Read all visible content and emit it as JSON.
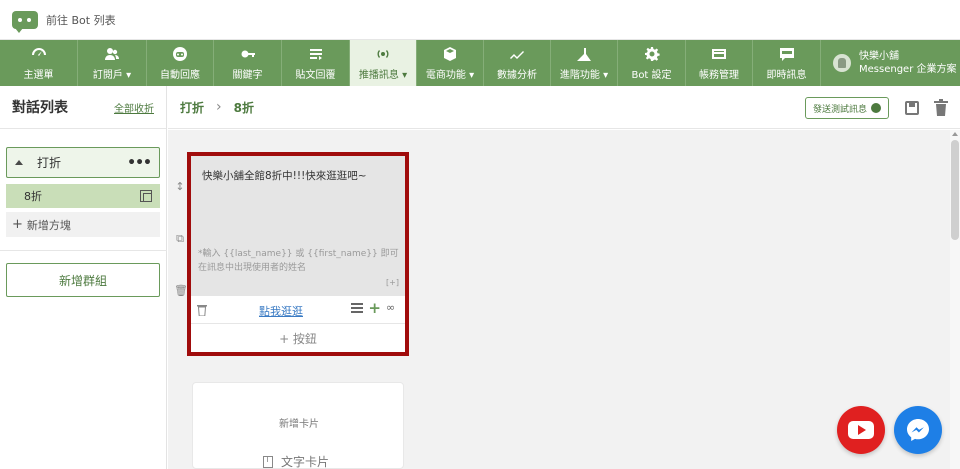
{
  "topbar": {
    "back_label": "前往 Bot 列表"
  },
  "nav": {
    "items": [
      {
        "label": "主選單",
        "icon": "dashboard-icon"
      },
      {
        "label": "訂閱戶 ▾",
        "icon": "users-icon"
      },
      {
        "label": "自動回應",
        "icon": "bot-face-icon"
      },
      {
        "label": "關鍵字",
        "icon": "key-icon"
      },
      {
        "label": "貼文回覆",
        "icon": "reply-icon"
      },
      {
        "label": "推播訊息 ▾",
        "icon": "broadcast-icon"
      },
      {
        "label": "電商功能 ▾",
        "icon": "box-icon"
      },
      {
        "label": "數據分析",
        "icon": "chart-line-icon"
      },
      {
        "label": "進階功能 ▾",
        "icon": "advanced-icon"
      },
      {
        "label": "Bot 設定",
        "icon": "gear-icon"
      },
      {
        "label": "帳務管理",
        "icon": "card-icon"
      },
      {
        "label": "即時訊息",
        "icon": "live-chat-icon"
      }
    ],
    "account": {
      "name": "快樂小舖",
      "plan": "Messenger 企業方案"
    }
  },
  "sidebar": {
    "title": "對話列表",
    "collapse_all": "全部收折",
    "group_name": "打折",
    "block_name": "8折",
    "add_block": "新增方塊",
    "new_group": "新增群組"
  },
  "content": {
    "breadcrumb": {
      "group": "打折",
      "block": "8折"
    },
    "test_button": "發送測試訊息",
    "card": {
      "text": "快樂小舖全館8折中!!!快來逛逛吧~",
      "hint": "*輸入 {{last_name}} 或 {{first_name}} 即可在訊息中出現使用者的姓名",
      "plus_tag": "[+]",
      "button_label": "點我逛逛",
      "add_button": "+ 按鈕"
    },
    "new_card": {
      "title": "新增卡片",
      "text_card": "文字卡片"
    }
  },
  "colors": {
    "brand_green": "#6a9a5b",
    "highlight_red": "#a00c0c",
    "youtube_red": "#e02020",
    "messenger_blue": "#1e7fe6"
  }
}
